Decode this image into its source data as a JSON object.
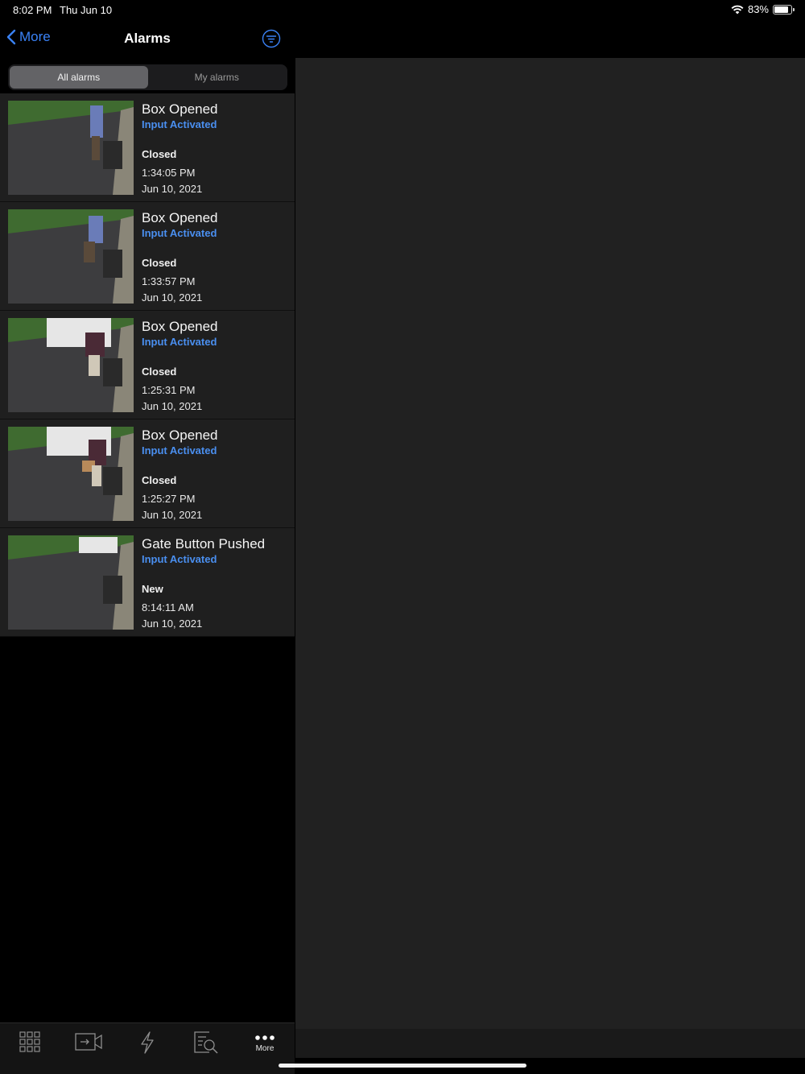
{
  "status_bar": {
    "time": "8:02 PM",
    "date": "Thu Jun 10",
    "battery": "83%",
    "battery_level": 0.83,
    "wifi_icon": "wifi-icon"
  },
  "nav": {
    "back_label": "More",
    "title": "Alarms",
    "filter_icon": "filter-icon"
  },
  "segments": [
    {
      "label": "All alarms",
      "selected": true
    },
    {
      "label": "My alarms",
      "selected": false
    }
  ],
  "alarms": [
    {
      "title": "Box Opened",
      "type": "Input Activated",
      "state": "Closed",
      "time": "1:34:05 PM",
      "date": "Jun 10, 2021"
    },
    {
      "title": "Box Opened",
      "type": "Input Activated",
      "state": "Closed",
      "time": "1:33:57 PM",
      "date": "Jun 10, 2021"
    },
    {
      "title": "Box Opened",
      "type": "Input Activated",
      "state": "Closed",
      "time": "1:25:31 PM",
      "date": "Jun 10, 2021"
    },
    {
      "title": "Box Opened",
      "type": "Input Activated",
      "state": "Closed",
      "time": "1:25:27 PM",
      "date": "Jun 10, 2021"
    },
    {
      "title": "Gate Button Pushed",
      "type": "Input Activated",
      "state": "New",
      "time": "8:14:11 AM",
      "date": "Jun 10, 2021"
    }
  ],
  "tab_bar": {
    "tabs": [
      {
        "icon": "grid-view-icon",
        "label": ""
      },
      {
        "icon": "camera-export-icon",
        "label": ""
      },
      {
        "icon": "alarm-lightning-icon",
        "label": ""
      },
      {
        "icon": "search-log-icon",
        "label": ""
      },
      {
        "icon": "more-dots-icon",
        "label": "More"
      }
    ]
  },
  "colors": {
    "accent": "#3a82f7",
    "row_bg": "#1f1f1f",
    "pane_bg": "#212121"
  }
}
